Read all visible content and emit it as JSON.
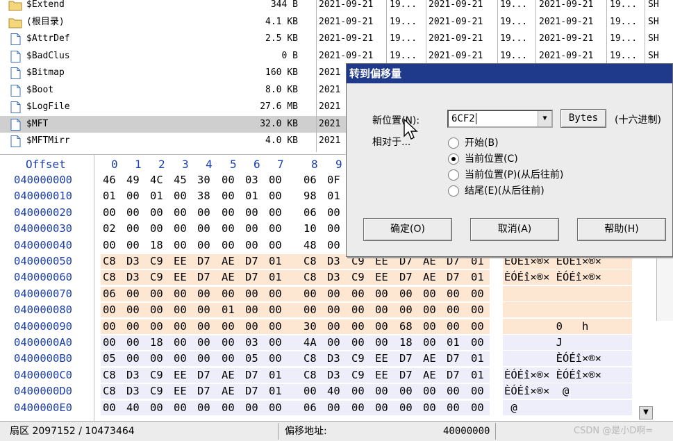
{
  "files": [
    {
      "name": "$Extend",
      "size": "344 B",
      "d1": "2021-09-21",
      "t1": "19...",
      "d2": "2021-09-21",
      "t2": "19...",
      "d3": "2021-09-21",
      "t3": "19...",
      "attr": "SH",
      "icon": "folder-icon"
    },
    {
      "name": "(根目录)",
      "size": "4.1 KB",
      "d1": "2021-09-21",
      "t1": "19...",
      "d2": "2021-09-21",
      "t2": "19...",
      "d3": "2021-09-21",
      "t3": "19...",
      "attr": "SH",
      "icon": "folder-icon"
    },
    {
      "name": "$AttrDef",
      "size": "2.5 KB",
      "d1": "2021-09-21",
      "t1": "19...",
      "d2": "2021-09-21",
      "t2": "19...",
      "d3": "2021-09-21",
      "t3": "19...",
      "attr": "SH",
      "icon": "file-icon"
    },
    {
      "name": "$BadClus",
      "size": "0 B",
      "d1": "2021-09-21",
      "t1": "19...",
      "d2": "2021-09-21",
      "t2": "19...",
      "d3": "2021-09-21",
      "t3": "19...",
      "attr": "SH",
      "icon": "file-icon"
    },
    {
      "name": "$Bitmap",
      "size": "160 KB",
      "d1": "2021",
      "t1": "",
      "d2": "",
      "t2": "",
      "d3": "",
      "t3": "",
      "attr": "",
      "icon": "file-icon"
    },
    {
      "name": "$Boot",
      "size": "8.0 KB",
      "d1": "2021",
      "t1": "",
      "d2": "",
      "t2": "",
      "d3": "",
      "t3": "",
      "attr": "",
      "icon": "file-icon"
    },
    {
      "name": "$LogFile",
      "size": "27.6 MB",
      "d1": "2021",
      "t1": "",
      "d2": "",
      "t2": "",
      "d3": "",
      "t3": "",
      "attr": "",
      "icon": "file-icon"
    },
    {
      "name": "$MFT",
      "size": "32.0 KB",
      "d1": "2021",
      "t1": "",
      "d2": "",
      "t2": "",
      "d3": "",
      "t3": "",
      "attr": "",
      "icon": "file-icon"
    },
    {
      "name": "$MFTMirr",
      "size": "4.0 KB",
      "d1": "2021",
      "t1": "",
      "d2": "",
      "t2": "",
      "d3": "",
      "t3": "",
      "attr": "",
      "icon": "file-icon"
    }
  ],
  "hex": {
    "header_label": "Offset",
    "columns": [
      "0",
      "1",
      "2",
      "3",
      "4",
      "5",
      "6",
      "7",
      "8",
      "9"
    ],
    "rows": [
      {
        "offset": "040000000",
        "bytes": [
          "46",
          "49",
          "4C",
          "45",
          "30",
          "00",
          "03",
          "00",
          "06",
          "0F"
        ],
        "ascii": ""
      },
      {
        "offset": "040000010",
        "bytes": [
          "01",
          "00",
          "01",
          "00",
          "38",
          "00",
          "01",
          "00",
          "98",
          "01"
        ],
        "ascii": ""
      },
      {
        "offset": "040000020",
        "bytes": [
          "00",
          "00",
          "00",
          "00",
          "00",
          "00",
          "00",
          "00",
          "06",
          "00"
        ],
        "ascii": ""
      },
      {
        "offset": "040000030",
        "bytes": [
          "02",
          "00",
          "00",
          "00",
          "00",
          "00",
          "00",
          "00",
          "10",
          "00"
        ],
        "ascii": ""
      },
      {
        "offset": "040000040",
        "bytes": [
          "00",
          "00",
          "18",
          "00",
          "00",
          "00",
          "00",
          "00",
          "48",
          "00"
        ],
        "ascii": ""
      },
      {
        "offset": "040000050",
        "bytes": [
          "C8",
          "D3",
          "C9",
          "EE",
          "D7",
          "AE",
          "D7",
          "01",
          "C8",
          "D3",
          "C9",
          "EE",
          "D7",
          "AE",
          "D7",
          "01"
        ],
        "ascii": "ÈÓÉî×®× ÈÓÉî×®×"
      },
      {
        "offset": "040000060",
        "bytes": [
          "C8",
          "D3",
          "C9",
          "EE",
          "D7",
          "AE",
          "D7",
          "01",
          "C8",
          "D3",
          "C9",
          "EE",
          "D7",
          "AE",
          "D7",
          "01"
        ],
        "ascii": "ÈÓÉî×®× ÈÓÉî×®×"
      },
      {
        "offset": "040000070",
        "bytes": [
          "06",
          "00",
          "00",
          "00",
          "00",
          "00",
          "00",
          "00",
          "00",
          "00",
          "00",
          "00",
          "00",
          "00",
          "00",
          "00"
        ],
        "ascii": ""
      },
      {
        "offset": "040000080",
        "bytes": [
          "00",
          "00",
          "00",
          "00",
          "00",
          "01",
          "00",
          "00",
          "00",
          "00",
          "00",
          "00",
          "00",
          "00",
          "00",
          "00"
        ],
        "ascii": ""
      },
      {
        "offset": "040000090",
        "bytes": [
          "00",
          "00",
          "00",
          "00",
          "00",
          "00",
          "00",
          "00",
          "30",
          "00",
          "00",
          "00",
          "68",
          "00",
          "00",
          "00"
        ],
        "ascii": "        0   h"
      },
      {
        "offset": "0400000A0",
        "bytes": [
          "00",
          "00",
          "18",
          "00",
          "00",
          "00",
          "03",
          "00",
          "4A",
          "00",
          "00",
          "00",
          "18",
          "00",
          "01",
          "00"
        ],
        "ascii": "        J"
      },
      {
        "offset": "0400000B0",
        "bytes": [
          "05",
          "00",
          "00",
          "00",
          "00",
          "00",
          "05",
          "00",
          "C8",
          "D3",
          "C9",
          "EE",
          "D7",
          "AE",
          "D7",
          "01"
        ],
        "ascii": "        ÈÓÉî×®×"
      },
      {
        "offset": "0400000C0",
        "bytes": [
          "C8",
          "D3",
          "C9",
          "EE",
          "D7",
          "AE",
          "D7",
          "01",
          "C8",
          "D3",
          "C9",
          "EE",
          "D7",
          "AE",
          "D7",
          "01"
        ],
        "ascii": "ÈÓÉî×®× ÈÓÉî×®×"
      },
      {
        "offset": "0400000D0",
        "bytes": [
          "C8",
          "D3",
          "C9",
          "EE",
          "D7",
          "AE",
          "D7",
          "01",
          "00",
          "40",
          "00",
          "00",
          "00",
          "00",
          "00",
          "00"
        ],
        "ascii": "ÈÓÉî×®×  @"
      },
      {
        "offset": "0400000E0",
        "bytes": [
          "00",
          "40",
          "00",
          "00",
          "00",
          "00",
          "00",
          "00",
          "06",
          "00",
          "00",
          "00",
          "00",
          "00",
          "00",
          "00"
        ],
        "ascii": " @"
      }
    ]
  },
  "status": {
    "sector": "扇区 2097152 / 10473464",
    "offset_label": "偏移地址:",
    "offset_value": "40000000",
    "watermark": "CSDN @是小D啊="
  },
  "dialog": {
    "title": "转到偏移量",
    "new_pos_label": "新位置(N):",
    "new_pos_value": "6CF2",
    "bytes_button": "Bytes",
    "hex_label": "(十六进制)",
    "relative_label": "相对于...",
    "radio": [
      {
        "label": "开始(B)",
        "checked": false
      },
      {
        "label": "当前位置(C)",
        "checked": true
      },
      {
        "label": "当前位置(P)(从后往前)",
        "checked": false
      },
      {
        "label": "结尾(E)(从后往前)",
        "checked": false
      }
    ],
    "ok": "确定(O)",
    "cancel": "取消(A)",
    "help": "帮助(H)"
  },
  "colors": {
    "title_bar": "#1f3a8a",
    "offset_text": "#1a3faa",
    "peach": "#fde6d2",
    "lavender": "#eeeefb"
  }
}
